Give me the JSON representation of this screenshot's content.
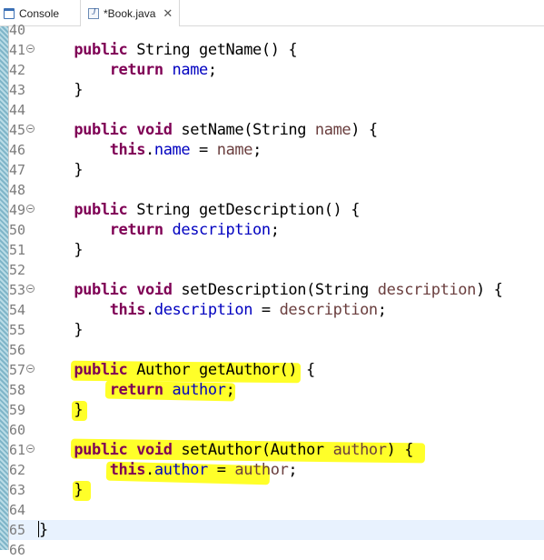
{
  "tabs": [
    {
      "label": "Console",
      "icon": "console-icon",
      "active": false
    },
    {
      "label": "*Book.java",
      "icon": "java-file-icon",
      "active": true
    }
  ],
  "colors": {
    "keyword": "#7f0055",
    "field": "#0000c0",
    "parameter": "#6a3e3e",
    "line_number": "#7c7c7c",
    "highlighter": "#ffff1e",
    "current_line": "#e8f2fe"
  },
  "editor": {
    "lines": [
      {
        "no": "40",
        "fold": false,
        "segments": []
      },
      {
        "no": "41",
        "fold": true,
        "segments": [
          {
            "t": "    "
          },
          {
            "t": "public",
            "c": "kw"
          },
          {
            "t": " String getName() {"
          }
        ]
      },
      {
        "no": "42",
        "fold": false,
        "segments": [
          {
            "t": "        "
          },
          {
            "t": "return",
            "c": "kw"
          },
          {
            "t": " "
          },
          {
            "t": "name",
            "c": "fld"
          },
          {
            "t": ";"
          }
        ]
      },
      {
        "no": "43",
        "fold": false,
        "segments": [
          {
            "t": "    }"
          }
        ]
      },
      {
        "no": "44",
        "fold": false,
        "segments": []
      },
      {
        "no": "45",
        "fold": true,
        "segments": [
          {
            "t": "    "
          },
          {
            "t": "public",
            "c": "kw"
          },
          {
            "t": " "
          },
          {
            "t": "void",
            "c": "kw"
          },
          {
            "t": " setName(String "
          },
          {
            "t": "name",
            "c": "par"
          },
          {
            "t": ") {"
          }
        ]
      },
      {
        "no": "46",
        "fold": false,
        "segments": [
          {
            "t": "        "
          },
          {
            "t": "this",
            "c": "kw"
          },
          {
            "t": "."
          },
          {
            "t": "name",
            "c": "fld"
          },
          {
            "t": " = "
          },
          {
            "t": "name",
            "c": "par"
          },
          {
            "t": ";"
          }
        ]
      },
      {
        "no": "47",
        "fold": false,
        "segments": [
          {
            "t": "    }"
          }
        ]
      },
      {
        "no": "48",
        "fold": false,
        "segments": []
      },
      {
        "no": "49",
        "fold": true,
        "segments": [
          {
            "t": "    "
          },
          {
            "t": "public",
            "c": "kw"
          },
          {
            "t": " String getDescription() {"
          }
        ]
      },
      {
        "no": "50",
        "fold": false,
        "segments": [
          {
            "t": "        "
          },
          {
            "t": "return",
            "c": "kw"
          },
          {
            "t": " "
          },
          {
            "t": "description",
            "c": "fld"
          },
          {
            "t": ";"
          }
        ]
      },
      {
        "no": "51",
        "fold": false,
        "segments": [
          {
            "t": "    }"
          }
        ]
      },
      {
        "no": "52",
        "fold": false,
        "segments": []
      },
      {
        "no": "53",
        "fold": true,
        "segments": [
          {
            "t": "    "
          },
          {
            "t": "public",
            "c": "kw"
          },
          {
            "t": " "
          },
          {
            "t": "void",
            "c": "kw"
          },
          {
            "t": " setDescription(String "
          },
          {
            "t": "description",
            "c": "par"
          },
          {
            "t": ") {"
          }
        ]
      },
      {
        "no": "54",
        "fold": false,
        "segments": [
          {
            "t": "        "
          },
          {
            "t": "this",
            "c": "kw"
          },
          {
            "t": "."
          },
          {
            "t": "description",
            "c": "fld"
          },
          {
            "t": " = "
          },
          {
            "t": "description",
            "c": "par"
          },
          {
            "t": ";"
          }
        ]
      },
      {
        "no": "55",
        "fold": false,
        "segments": [
          {
            "t": "    }"
          }
        ]
      },
      {
        "no": "56",
        "fold": false,
        "segments": []
      },
      {
        "no": "57",
        "fold": true,
        "segments": [
          {
            "t": "    "
          },
          {
            "t": "public",
            "c": "kw"
          },
          {
            "t": " Author getAuthor() {"
          }
        ]
      },
      {
        "no": "58",
        "fold": false,
        "segments": [
          {
            "t": "        "
          },
          {
            "t": "return",
            "c": "kw"
          },
          {
            "t": " "
          },
          {
            "t": "author",
            "c": "fld"
          },
          {
            "t": ";"
          }
        ]
      },
      {
        "no": "59",
        "fold": false,
        "segments": [
          {
            "t": "    }"
          }
        ]
      },
      {
        "no": "60",
        "fold": false,
        "segments": []
      },
      {
        "no": "61",
        "fold": true,
        "segments": [
          {
            "t": "    "
          },
          {
            "t": "public",
            "c": "kw"
          },
          {
            "t": " "
          },
          {
            "t": "void",
            "c": "kw"
          },
          {
            "t": " setAuthor(Author "
          },
          {
            "t": "author",
            "c": "par"
          },
          {
            "t": ") {"
          }
        ]
      },
      {
        "no": "62",
        "fold": false,
        "segments": [
          {
            "t": "        "
          },
          {
            "t": "this",
            "c": "kw"
          },
          {
            "t": "."
          },
          {
            "t": "author",
            "c": "fld"
          },
          {
            "t": " = "
          },
          {
            "t": "author",
            "c": "par"
          },
          {
            "t": ";"
          }
        ]
      },
      {
        "no": "63",
        "fold": false,
        "segments": [
          {
            "t": "    }"
          }
        ]
      },
      {
        "no": "64",
        "fold": false,
        "segments": []
      },
      {
        "no": "65",
        "fold": false,
        "cursor": true,
        "segments": [
          {
            "t": "}"
          }
        ]
      },
      {
        "no": "66",
        "fold": false,
        "segments": []
      }
    ]
  }
}
